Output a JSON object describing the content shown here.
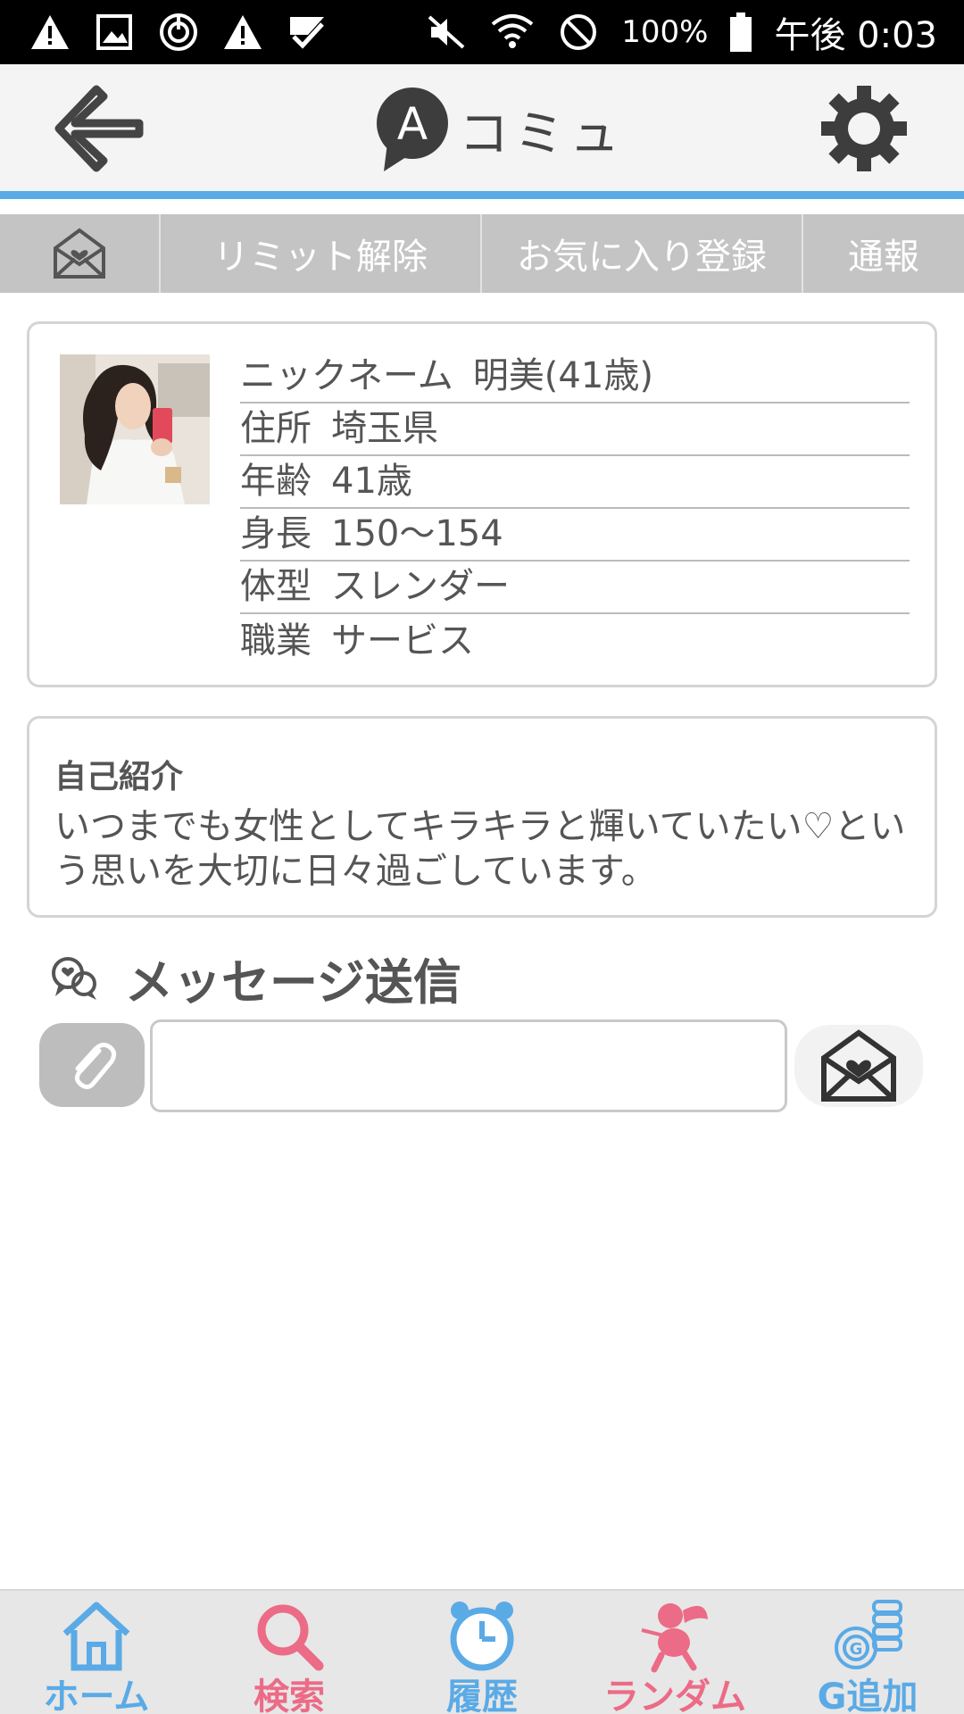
{
  "status_bar": {
    "battery_percent": "100%",
    "time": "午後 0:03"
  },
  "header": {
    "logo_letter": "A",
    "logo_text": "コミュ"
  },
  "action_bar": {
    "limit_label": "リミット解除",
    "favorite_label": "お気に入り登録",
    "report_label": "通報"
  },
  "profile": {
    "rows": [
      {
        "label": "ニックネーム",
        "value": "明美(41歳)"
      },
      {
        "label": "住所",
        "value": "埼玉県"
      },
      {
        "label": "年齢",
        "value": "41歳"
      },
      {
        "label": "身長",
        "value": "150〜154"
      },
      {
        "label": "体型",
        "value": "スレンダー"
      },
      {
        "label": "職業",
        "value": "サービス"
      }
    ]
  },
  "intro": {
    "title": "自己紹介",
    "body": "いつまでも女性としてキラキラと輝いていたい♡という思いを大切に日々過ごしています。"
  },
  "message": {
    "title": "メッセージ送信",
    "input_value": "",
    "input_placeholder": ""
  },
  "bottom_nav": {
    "items": [
      {
        "label": "ホーム",
        "icon": "home-icon",
        "color": "#5aaae6"
      },
      {
        "label": "検索",
        "icon": "search-icon",
        "color": "#ec6b86"
      },
      {
        "label": "履歴",
        "icon": "clock-icon",
        "color": "#5aaae6"
      },
      {
        "label": "ランダム",
        "icon": "cupid-icon",
        "color": "#ec6b86"
      },
      {
        "label": "G追加",
        "icon": "coins-icon",
        "color": "#5aaae6"
      }
    ]
  },
  "colors": {
    "accent_blue": "#5aaae6",
    "accent_pink": "#ec6b86",
    "tab_bar_gray": "#c4c4c4"
  }
}
